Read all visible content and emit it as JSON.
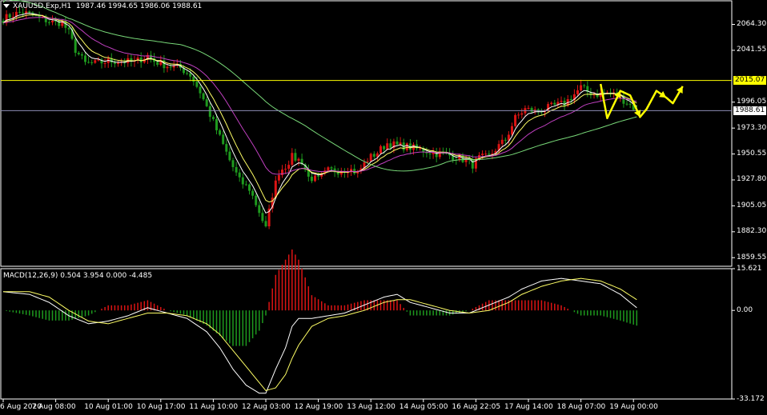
{
  "header": {
    "symbol": "XAUUSD.Exp,H1",
    "ohlc": "1987.46 1994.65 1986.06 1988.61"
  },
  "price_levels": {
    "resistance": "2015.07",
    "current": "1988.61"
  },
  "indicator": {
    "label": "MACD(12,26,9) 0.504 3.954 0.000 -4.485"
  },
  "colors": {
    "bull": "#dc1414",
    "bear": "#1e9a1e",
    "resistance_line": "#ffff00",
    "current_line": "#8c8cb4",
    "ma_fast": "#ffffff",
    "ma_mid": "#ffff66",
    "ma_slow_purple": "#c040c0",
    "ma_long_green": "#78d878",
    "arrow": "#ffff00"
  },
  "chart_data": [
    {
      "type": "candlestick",
      "title": "XAUUSD.Exp,H1",
      "ylim": [
        1852,
        2085
      ],
      "yticks": [
        "2064.30",
        "2041.55",
        "1996.05",
        "1973.30",
        "1950.55",
        "1927.80",
        "1905.05",
        "1882.30",
        "1859.55"
      ],
      "ytick_values": [
        2064.3,
        2041.55,
        1996.05,
        1973.3,
        1950.55,
        1927.8,
        1905.05,
        1882.3,
        1859.55
      ],
      "xlabels": [
        "6 Aug 2020",
        "7 Aug 08:00",
        "10 Aug 01:00",
        "10 Aug 17:00",
        "11 Aug 10:00",
        "12 Aug 03:00",
        "12 Aug 19:00",
        "13 Aug 12:00",
        "14 Aug 05:00",
        "16 Aug 22:05",
        "17 Aug 14:00",
        "18 Aug 07:00",
        "19 Aug 00:00"
      ],
      "xlabel_bars": [
        0,
        16,
        32,
        48,
        64,
        80,
        96,
        112,
        128,
        144,
        160,
        176,
        192
      ],
      "close_anchors": [
        [
          0,
          2069
        ],
        [
          3,
          2073
        ],
        [
          6,
          2075
        ],
        [
          9,
          2072
        ],
        [
          12,
          2069
        ],
        [
          15,
          2066
        ],
        [
          18,
          2066
        ],
        [
          20,
          2057
        ],
        [
          22,
          2042
        ],
        [
          25,
          2030
        ],
        [
          28,
          2030
        ],
        [
          32,
          2032
        ],
        [
          36,
          2032
        ],
        [
          40,
          2031
        ],
        [
          44,
          2037
        ],
        [
          46,
          2032
        ],
        [
          50,
          2028
        ],
        [
          54,
          2026
        ],
        [
          57,
          2020
        ],
        [
          60,
          2005
        ],
        [
          63,
          1985
        ],
        [
          66,
          1965
        ],
        [
          69,
          1945
        ],
        [
          72,
          1927
        ],
        [
          75,
          1920
        ],
        [
          78,
          1900
        ],
        [
          80,
          1885
        ],
        [
          82,
          1915
        ],
        [
          84,
          1935
        ],
        [
          86,
          1940
        ],
        [
          88,
          1948
        ],
        [
          91,
          1944
        ],
        [
          93,
          1930
        ],
        [
          96,
          1928
        ],
        [
          99,
          1936
        ],
        [
          102,
          1936
        ],
        [
          105,
          1938
        ],
        [
          108,
          1934
        ],
        [
          111,
          1946
        ],
        [
          114,
          1952
        ],
        [
          117,
          1960
        ],
        [
          120,
          1958
        ],
        [
          123,
          1957
        ],
        [
          126,
          1955
        ],
        [
          129,
          1953
        ],
        [
          132,
          1951
        ],
        [
          135,
          1950
        ],
        [
          138,
          1948
        ],
        [
          141,
          1945
        ],
        [
          143,
          1941
        ],
        [
          145,
          1947
        ],
        [
          148,
          1948
        ],
        [
          150,
          1955
        ],
        [
          153,
          1963
        ],
        [
          156,
          1982
        ],
        [
          159,
          1990
        ],
        [
          162,
          1988
        ],
        [
          165,
          1990
        ],
        [
          168,
          1993
        ],
        [
          171,
          1995
        ],
        [
          174,
          2003
        ],
        [
          176,
          2009
        ],
        [
          178,
          2005
        ],
        [
          181,
          2003
        ],
        [
          184,
          2004
        ],
        [
          187,
          2002
        ],
        [
          190,
          1996
        ],
        [
          193,
          1989
        ]
      ],
      "current_price": 1988.61,
      "resistance_price": 2015.07,
      "forecast_path": [
        [
          182,
          2012
        ],
        [
          184,
          1982
        ],
        [
          188,
          2006
        ],
        [
          191,
          2002
        ],
        [
          194,
          1983
        ],
        [
          196,
          1990
        ],
        [
          199,
          2006
        ],
        [
          202,
          2000
        ],
        [
          204,
          1995
        ],
        [
          207,
          2010
        ]
      ]
    },
    {
      "type": "macd",
      "title": "MACD(12,26,9) 0.504 3.954 0.000 -4.485",
      "ylim": [
        -33.172,
        15.621
      ],
      "yticks": [
        "15.621",
        "0.00",
        "-33.172"
      ],
      "ytick_values": [
        15.621,
        0,
        -33.172
      ],
      "macd_anchors": [
        [
          0,
          7
        ],
        [
          8,
          6
        ],
        [
          14,
          3
        ],
        [
          20,
          -2
        ],
        [
          26,
          -5
        ],
        [
          32,
          -4
        ],
        [
          38,
          -2
        ],
        [
          44,
          1
        ],
        [
          50,
          -1
        ],
        [
          56,
          -3
        ],
        [
          62,
          -8
        ],
        [
          66,
          -14
        ],
        [
          70,
          -22
        ],
        [
          74,
          -28
        ],
        [
          78,
          -31
        ],
        [
          80,
          -31
        ],
        [
          83,
          -22
        ],
        [
          86,
          -14
        ],
        [
          88,
          -6
        ],
        [
          90,
          -3
        ],
        [
          94,
          -3
        ],
        [
          99,
          -2
        ],
        [
          104,
          -1
        ],
        [
          110,
          2
        ],
        [
          116,
          5
        ],
        [
          120,
          6
        ],
        [
          124,
          3
        ],
        [
          130,
          1
        ],
        [
          136,
          -1
        ],
        [
          142,
          -1
        ],
        [
          148,
          2
        ],
        [
          154,
          5
        ],
        [
          158,
          8
        ],
        [
          164,
          11
        ],
        [
          170,
          12
        ],
        [
          176,
          11
        ],
        [
          182,
          10
        ],
        [
          188,
          6
        ],
        [
          193,
          1
        ]
      ],
      "signal_anchors": [
        [
          0,
          7
        ],
        [
          8,
          7
        ],
        [
          14,
          5
        ],
        [
          20,
          0
        ],
        [
          26,
          -4
        ],
        [
          32,
          -5
        ],
        [
          38,
          -3
        ],
        [
          44,
          -1
        ],
        [
          50,
          -1
        ],
        [
          56,
          -2
        ],
        [
          62,
          -5
        ],
        [
          66,
          -9
        ],
        [
          70,
          -15
        ],
        [
          74,
          -21
        ],
        [
          78,
          -27
        ],
        [
          80,
          -30
        ],
        [
          83,
          -29
        ],
        [
          86,
          -24
        ],
        [
          88,
          -18
        ],
        [
          90,
          -13
        ],
        [
          94,
          -6
        ],
        [
          99,
          -3
        ],
        [
          104,
          -2
        ],
        [
          110,
          0
        ],
        [
          116,
          3
        ],
        [
          120,
          4
        ],
        [
          124,
          4
        ],
        [
          130,
          2
        ],
        [
          136,
          0
        ],
        [
          142,
          -1
        ],
        [
          148,
          0
        ],
        [
          154,
          3
        ],
        [
          158,
          6
        ],
        [
          164,
          9
        ],
        [
          170,
          11
        ],
        [
          176,
          12
        ],
        [
          182,
          11
        ],
        [
          188,
          8
        ],
        [
          193,
          4
        ]
      ]
    }
  ]
}
